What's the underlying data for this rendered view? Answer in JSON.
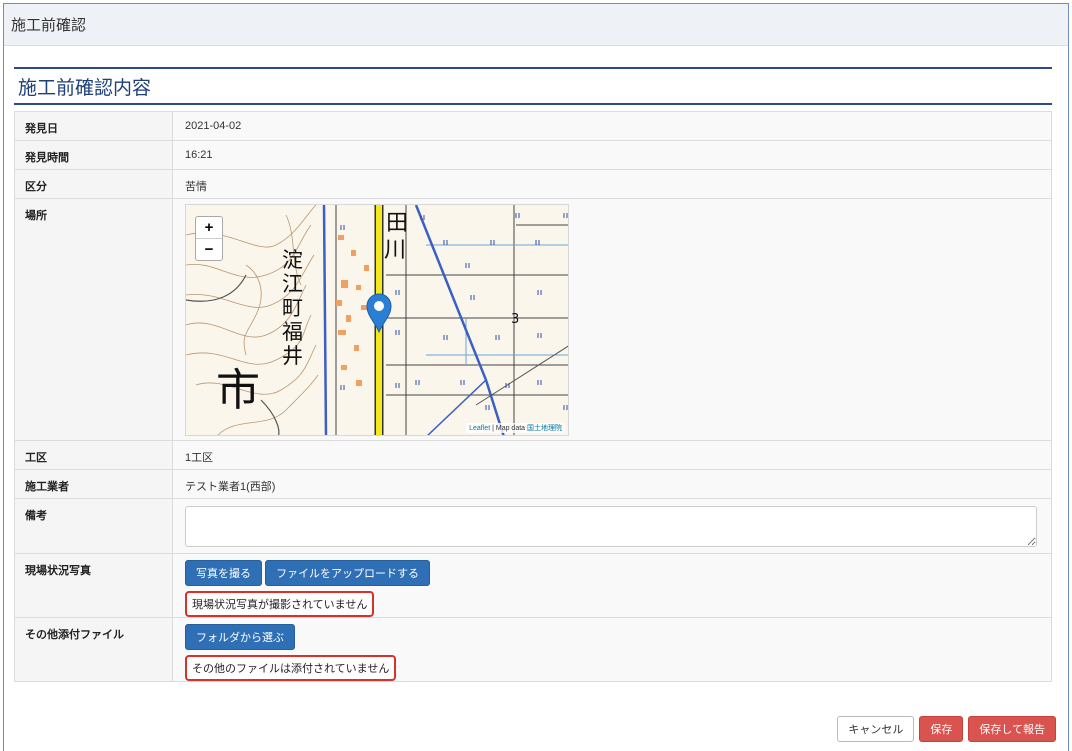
{
  "header": {
    "title": "施工前確認"
  },
  "section": {
    "title": "施工前確認内容"
  },
  "rows": {
    "discovery_date": {
      "label": "発見日",
      "value": "2021-04-02"
    },
    "discovery_time": {
      "label": "発見時間",
      "value": "16:21"
    },
    "category": {
      "label": "区分",
      "value": "苦情"
    },
    "location": {
      "label": "場所"
    },
    "work_area": {
      "label": "工区",
      "value": "1工区"
    },
    "contractor": {
      "label": "施工業者",
      "value": "テスト業者1(西部)"
    },
    "remarks": {
      "label": "備考",
      "value": ""
    },
    "site_photos": {
      "label": "現場状況写真",
      "take_photo_button": "写真を撮る",
      "upload_button": "ファイルをアップロードする",
      "warning": "現場状況写真が撮影されていません"
    },
    "other_files": {
      "label": "その他添付ファイル",
      "select_folder_button": "フォルダから選ぶ",
      "warning": "その他のファイルは添付されていません"
    }
  },
  "map": {
    "zoom_in": "+",
    "zoom_out": "−",
    "attribution_leaflet": "Leaflet",
    "attribution_sep": " | Map data ",
    "attribution_gsi": "国土地理院",
    "labels": [
      "田",
      "川",
      "淀",
      "江",
      "町",
      "福",
      "井",
      "市",
      "3"
    ],
    "marker_color": "#2a7fd4"
  },
  "footer": {
    "cancel": "キャンセル",
    "save": "保存",
    "save_report": "保存して報告"
  }
}
